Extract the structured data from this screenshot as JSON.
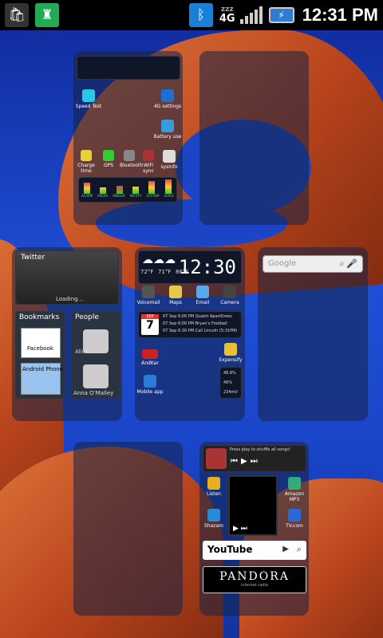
{
  "status_bar": {
    "time": "12:31 PM",
    "network": "4G",
    "sleep": "zzz"
  },
  "screen1": {
    "apps": [
      {
        "label": "Speed Test"
      },
      {
        "label": "4G settings"
      },
      {
        "label": "Battery use"
      },
      {
        "label": "sysinfo"
      }
    ],
    "power_labels": [
      "Charge time",
      "GPS",
      "Bluetooth",
      "WiFi sync"
    ],
    "eq_labels": [
      "ALARM",
      "MEDIA",
      "RINGER",
      "NOTIFY",
      "SYSTEM",
      "VOICE"
    ]
  },
  "screen2": {
    "twitter": {
      "title": "Twitter",
      "status": "Loading..."
    },
    "bookmarks": {
      "title": "Bookmarks",
      "items": [
        "Facebook",
        "Android Phone"
      ]
    },
    "people": {
      "title": "People",
      "contacts": [
        "Alice",
        "Anna O'Malley"
      ]
    }
  },
  "screen3": {
    "clock": "12:30",
    "weather": [
      "72°F",
      "71°F",
      "86°F"
    ],
    "apps": [
      {
        "label": "Voicemail"
      },
      {
        "label": "Maps"
      },
      {
        "label": "Email"
      },
      {
        "label": "Camera"
      }
    ],
    "calendar": {
      "month": "SEP",
      "day": "7",
      "events": [
        "07 Sep 6:00 PM Quaint ApartDress",
        "07 Sep 6:00 PM Bryan's Football",
        "07 Sep 6:30 PM Call Lincoln (5:31PM)"
      ]
    },
    "bottom": [
      {
        "label": "AndKar"
      },
      {
        "label": "Mobile app"
      },
      {
        "label": "Expensify"
      }
    ],
    "mini_stats": [
      "48.8%",
      "46%",
      "234mV"
    ]
  },
  "screen4": {
    "search": {
      "placeholder": "Google"
    }
  },
  "screen6": {
    "pandora_prompt": "Press play to shuffle all songs!",
    "apps": [
      {
        "label": "Listen"
      },
      {
        "label": "Shazam"
      },
      {
        "label": "Amazon MP3"
      },
      {
        "label": "TV.com"
      }
    ],
    "youtube": "YouTube",
    "pandora": "PANDORA",
    "pandora_sub": "internet radio"
  }
}
